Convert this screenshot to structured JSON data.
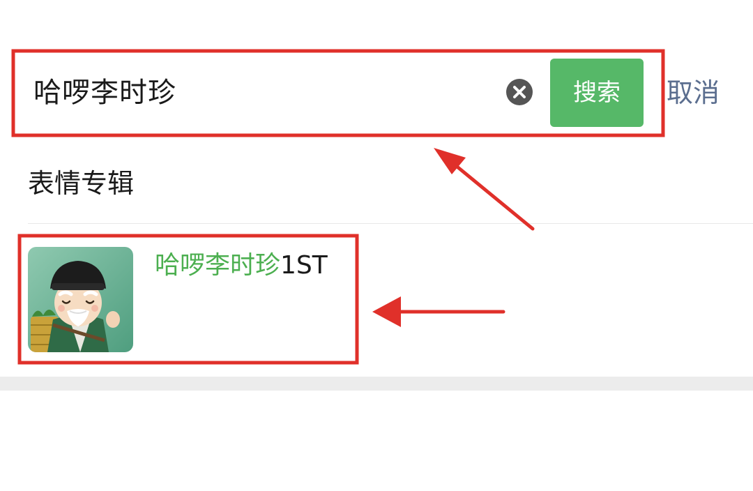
{
  "search": {
    "query": "哈啰李时珍",
    "button_label": "搜索",
    "cancel_label": "取消"
  },
  "section": {
    "title": "表情专辑"
  },
  "result": {
    "title_highlight": "哈啰李时珍",
    "title_suffix": "1ST"
  },
  "icons": {
    "clear": "clear-icon",
    "thumbnail": "sticker-album-thumbnail"
  },
  "colors": {
    "accent_green": "#56b868",
    "highlight_green": "#4caf50",
    "cancel_blue_gray": "#5b6e8f",
    "annotation_red": "#e0302a"
  }
}
